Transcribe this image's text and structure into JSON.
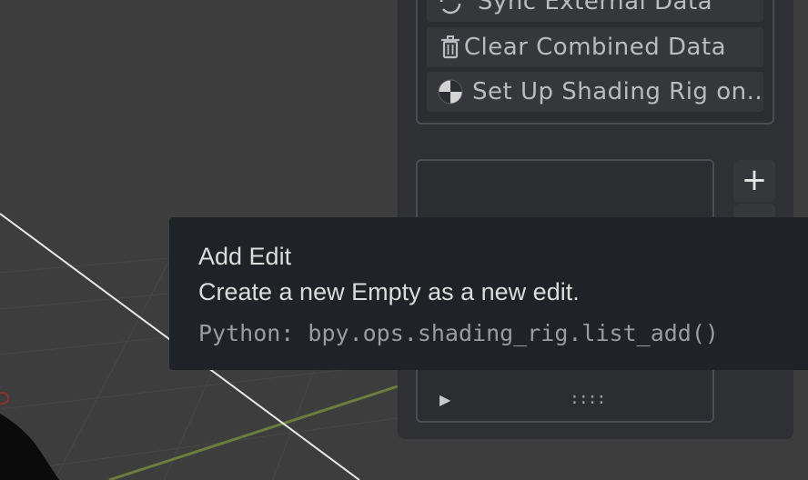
{
  "viewport": {
    "background_color": "#3d3d3d",
    "grid_line_color": "#5a6a3a"
  },
  "panel": {
    "operators": [
      {
        "label": "Sync External Data",
        "icon": "sync-icon"
      },
      {
        "label": "Clear Combined Data",
        "icon": "trash-icon"
      },
      {
        "label": "Set Up Shading Rig on...",
        "icon": "shading-sphere-icon"
      }
    ],
    "add_button": {
      "label": "+",
      "icon": "plus-icon"
    },
    "list_footer": {
      "expand_icon": "▶",
      "grip": "::::"
    }
  },
  "tooltip": {
    "title": "Add Edit",
    "description": "Create a new Empty as a new edit.",
    "python": "Python: bpy.ops.shading_rig.list_add()"
  }
}
